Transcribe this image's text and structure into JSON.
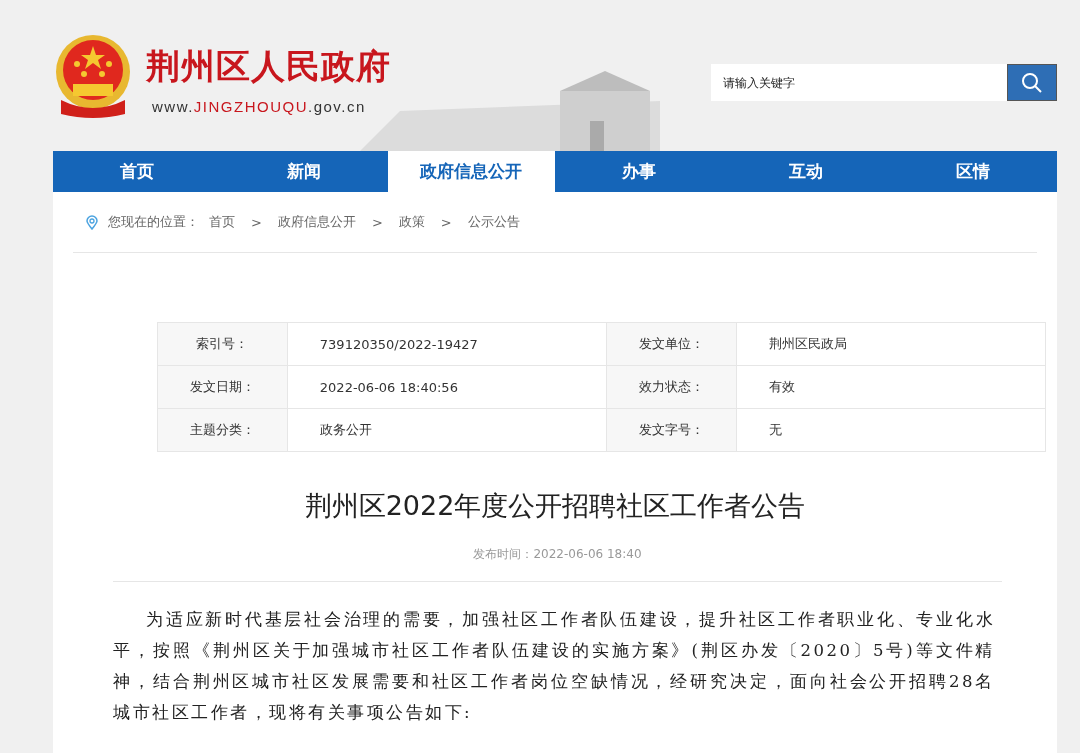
{
  "header": {
    "site_name": "荆州区人民政府",
    "url_prefix": "www.",
    "url_domain": "JINGZHOUQU",
    "url_suffix": ".gov.cn",
    "search": {
      "placeholder": "请输入关键字"
    }
  },
  "nav": [
    {
      "label": "首页",
      "selected": false
    },
    {
      "label": "新闻",
      "selected": false
    },
    {
      "label": "政府信息公开",
      "selected": true
    },
    {
      "label": "办事",
      "selected": false
    },
    {
      "label": "互动",
      "selected": false
    },
    {
      "label": "区情",
      "selected": false
    }
  ],
  "breadcrumb": {
    "prefix": "您现在的位置：",
    "items": [
      "首页",
      "政府信息公开",
      "政策",
      "公示公告"
    ],
    "separator": ">"
  },
  "meta": [
    {
      "label": "索引号：",
      "value": "739120350/2022-19427",
      "label2": "发文单位：",
      "value2": "荆州区民政局"
    },
    {
      "label": "发文日期：",
      "value": "2022-06-06 18:40:56",
      "label2": "效力状态：",
      "value2": "有效"
    },
    {
      "label": "主题分类：",
      "value": "政务公开",
      "label2": "发文字号：",
      "value2": "无"
    }
  ],
  "article": {
    "title": "荆州区2022年度公开招聘社区工作者公告",
    "published": "发布时间：2022-06-06 18:40",
    "paragraph": "为适应新时代基层社会治理的需要，加强社区工作者队伍建设，提升社区工作者职业化、专业化水平，按照《荆州区关于加强城市社区工作者队伍建设的实施方案》(荆区办发〔2020〕5号)等文件精神，结合荆州区城市社区发展需要和社区工作者岗位空缺情况，经研究决定，面向社会公开招聘28名城市社区工作者，现将有关事项公告如下:"
  }
}
